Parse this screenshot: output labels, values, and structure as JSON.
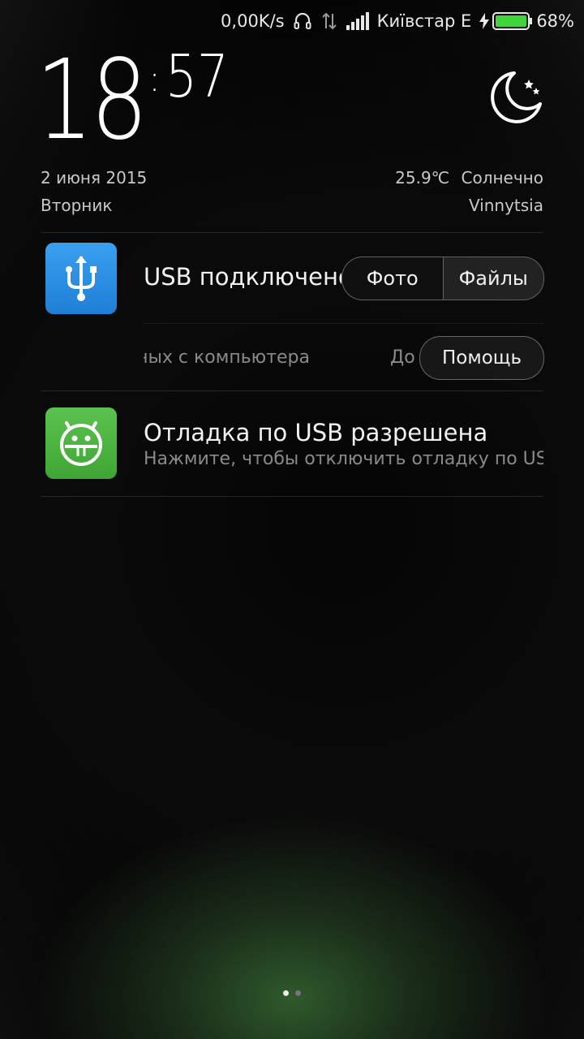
{
  "status_bar": {
    "net_speed": "0,00K/s",
    "carrier": "Київстар",
    "network_type": "E",
    "battery_percent": "68%",
    "battery_level": 0.68,
    "icons": [
      "headset-icon",
      "data-transfer-icon",
      "signal-icon",
      "charging-icon",
      "battery-icon"
    ]
  },
  "lockscreen": {
    "hours": "18",
    "colon": ":",
    "minutes": "57",
    "date": "2 июня 2015",
    "weekday": "Вторник",
    "temperature": "25.9℃",
    "condition": "Солнечно",
    "city": "Vinnytsia",
    "weather_icon": "moon-stars-icon"
  },
  "notifications": [
    {
      "icon": "usb-icon",
      "icon_color": "#2b8ee5",
      "title": "USB подключено",
      "subtitle": "Режим передачи данных с компьютера",
      "actions": [
        "Фото",
        "Файлы"
      ],
      "secondary_hint": "До",
      "help_label": "Помощь"
    },
    {
      "icon": "android-debug-icon",
      "icon_color": "#4cb441",
      "title": "Отладка по USB разрешена",
      "subtitle": "Нажмите, чтобы отключить отладку по USB"
    }
  ],
  "pager": {
    "pages": 2,
    "current": 1
  }
}
